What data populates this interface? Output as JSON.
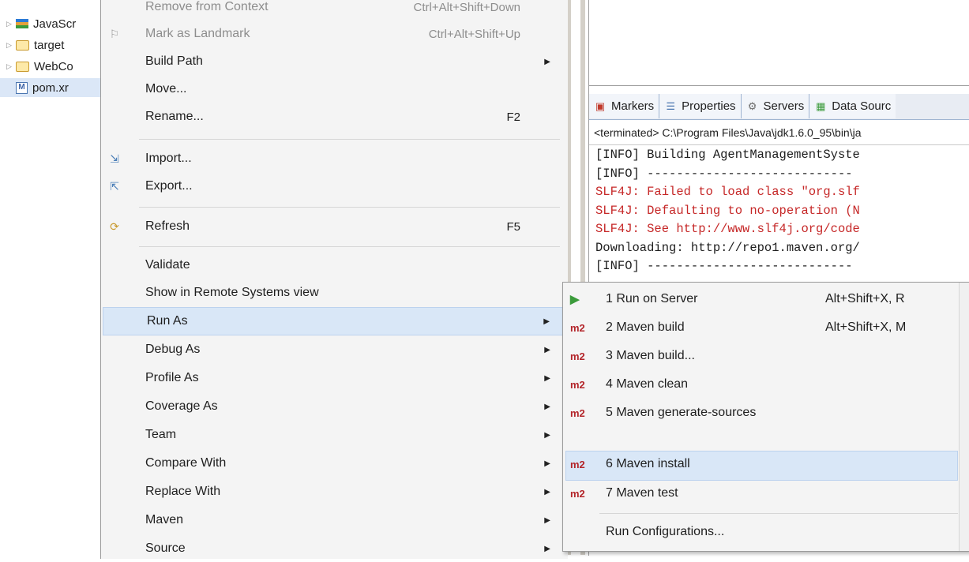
{
  "tree": {
    "items": [
      {
        "label": "JavaScr",
        "icon": "library-icon"
      },
      {
        "label": "target",
        "icon": "folder-icon"
      },
      {
        "label": "WebCo",
        "icon": "folder-icon"
      },
      {
        "label": "pom.xr",
        "icon": "maven-file-icon"
      }
    ]
  },
  "menu": {
    "remove_label": "Remove from Context",
    "remove_short": "Ctrl+Alt+Shift+Down",
    "landmark_label": "Mark as Landmark",
    "landmark_short": "Ctrl+Alt+Shift+Up",
    "build_path": "Build Path",
    "move": "Move...",
    "rename": "Rename...",
    "rename_short": "F2",
    "import": "Import...",
    "export": "Export...",
    "refresh": "Refresh",
    "refresh_short": "F5",
    "validate": "Validate",
    "remote": "Show in Remote Systems view",
    "run_as": "Run As",
    "debug_as": "Debug As",
    "profile_as": "Profile As",
    "coverage_as": "Coverage As",
    "team": "Team",
    "compare_with": "Compare With",
    "replace_with": "Replace With",
    "maven": "Maven",
    "source": "Source"
  },
  "tabs": [
    {
      "label": "Markers",
      "icon": "markers-icon"
    },
    {
      "label": "Properties",
      "icon": "properties-icon"
    },
    {
      "label": "Servers",
      "icon": "servers-icon"
    },
    {
      "label": "Data Sourc",
      "icon": "data-source-icon"
    }
  ],
  "console": {
    "status": "<terminated> C:\\Program Files\\Java\\jdk1.6.0_95\\bin\\ja",
    "lines": [
      {
        "text": "[INFO] Building AgentManagementSyste",
        "error": false
      },
      {
        "text": "[INFO] ----------------------------",
        "error": false
      },
      {
        "text": "SLF4J: Failed to load class \"org.slf",
        "error": true
      },
      {
        "text": "SLF4J: Defaulting to no-operation (N",
        "error": true
      },
      {
        "text": "SLF4J: See http://www.slf4j.org/code",
        "error": true
      },
      {
        "text": "Downloading: http://repo1.maven.org/",
        "error": false
      },
      {
        "text": "[INFO] ----------------------------",
        "error": false
      }
    ]
  },
  "submenu": {
    "run_server": "1 Run on Server",
    "run_server_short": "Alt+Shift+X, R",
    "maven_build": "2 Maven build",
    "maven_build_short": "Alt+Shift+X, M",
    "maven_build_dots": "3 Maven build...",
    "maven_clean": "4 Maven clean",
    "maven_gen": "5 Maven generate-sources",
    "maven_install": "6 Maven install",
    "maven_test": "7 Maven test",
    "run_configs": "Run Configurations...",
    "m2_badge": "m2"
  },
  "colors": {
    "hover_bg": "#d9e7f7",
    "error_text": "#c62828",
    "m2_badge": "#b3252a"
  }
}
